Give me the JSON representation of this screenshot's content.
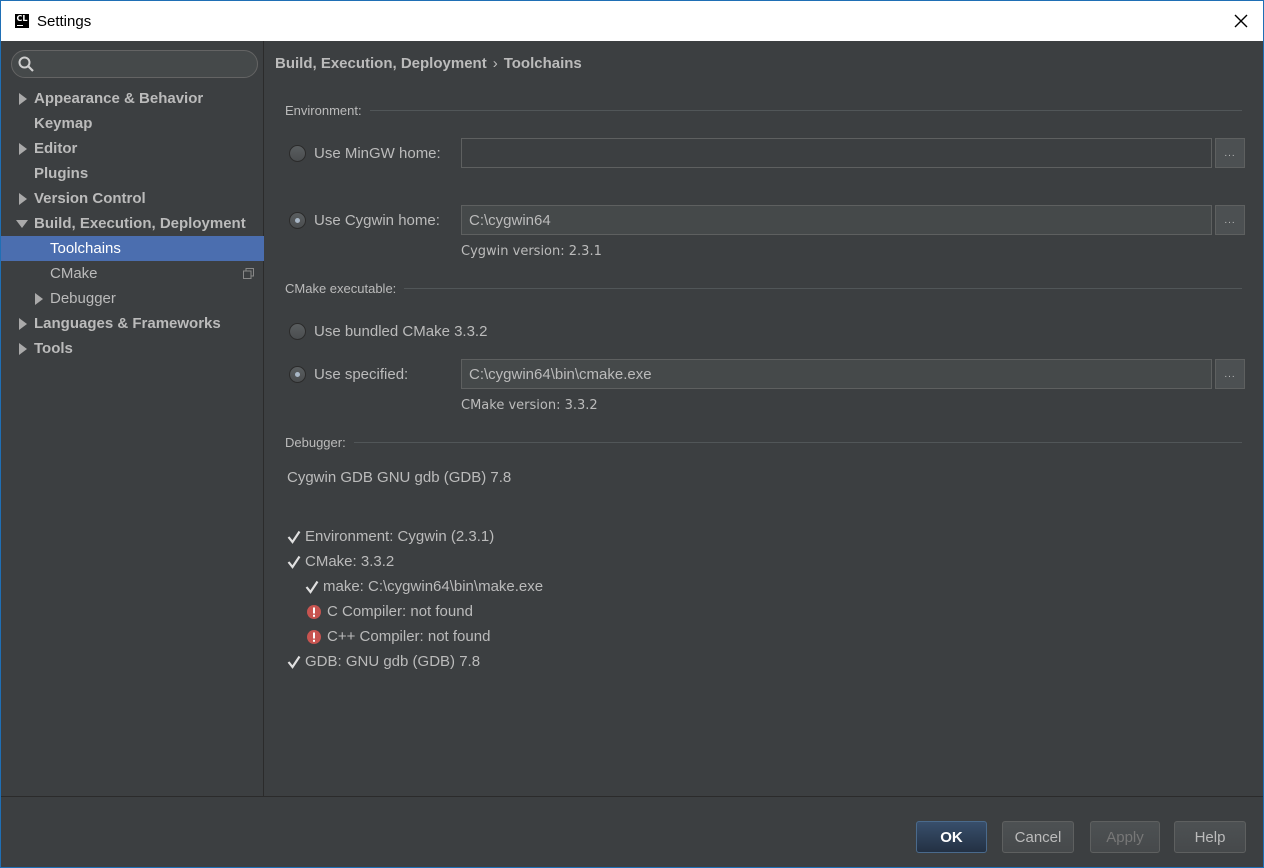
{
  "window": {
    "app_icon_text": "CL",
    "title": "Settings"
  },
  "sidebar": {
    "search": {
      "value": "",
      "placeholder": ""
    },
    "items": [
      {
        "label": "Appearance & Behavior",
        "arrow": "right"
      },
      {
        "label": "Keymap",
        "arrow": "none"
      },
      {
        "label": "Editor",
        "arrow": "right"
      },
      {
        "label": "Plugins",
        "arrow": "none"
      },
      {
        "label": "Version Control",
        "arrow": "right"
      },
      {
        "label": "Build, Execution, Deployment",
        "arrow": "down"
      },
      {
        "label": "Toolchains",
        "arrow": "none",
        "selected": true
      },
      {
        "label": "CMake",
        "arrow": "none",
        "icon": "copy-icon"
      },
      {
        "label": "Debugger",
        "arrow": "right"
      },
      {
        "label": "Languages & Frameworks",
        "arrow": "right"
      },
      {
        "label": "Tools",
        "arrow": "right"
      }
    ]
  },
  "content": {
    "breadcrumb": {
      "parent": "Build, Execution, Deployment",
      "separator": "›",
      "current": "Toolchains"
    },
    "environment": {
      "title": "Environment:",
      "mingw": {
        "label": "Use MinGW home:",
        "value": "",
        "checked": false,
        "browse": "..."
      },
      "cygwin": {
        "label": "Use Cygwin home:",
        "value": "C:\\cygwin64",
        "checked": true,
        "browse": "..."
      },
      "cygwin_version": "Cygwin version: 2.3.1"
    },
    "cmake": {
      "title": "CMake executable:",
      "bundled": {
        "label": "Use bundled CMake 3.3.2",
        "checked": false
      },
      "specified": {
        "label": "Use specified:",
        "value": "C:\\cygwin64\\bin\\cmake.exe",
        "checked": true,
        "browse": "..."
      },
      "cmake_version": "CMake version: 3.3.2"
    },
    "debugger": {
      "title": "Debugger:",
      "value": "Cygwin GDB GNU gdb (GDB) 7.8"
    },
    "status": {
      "environment": "Environment: Cygwin (2.3.1)",
      "cmake": "CMake: 3.3.2",
      "make": "make: C:\\cygwin64\\bin\\make.exe",
      "c_compiler": "C Compiler: not found",
      "cpp_compiler": "C++ Compiler: not found",
      "gdb": "GDB: GNU gdb (GDB) 7.8"
    }
  },
  "buttons": {
    "ok": "OK",
    "cancel": "Cancel",
    "apply": "Apply",
    "help": "Help"
  },
  "colors": {
    "background": "#3c3f41",
    "selection": "#4b6eaf",
    "error": "#c75450",
    "text": "#bbbbbb"
  }
}
